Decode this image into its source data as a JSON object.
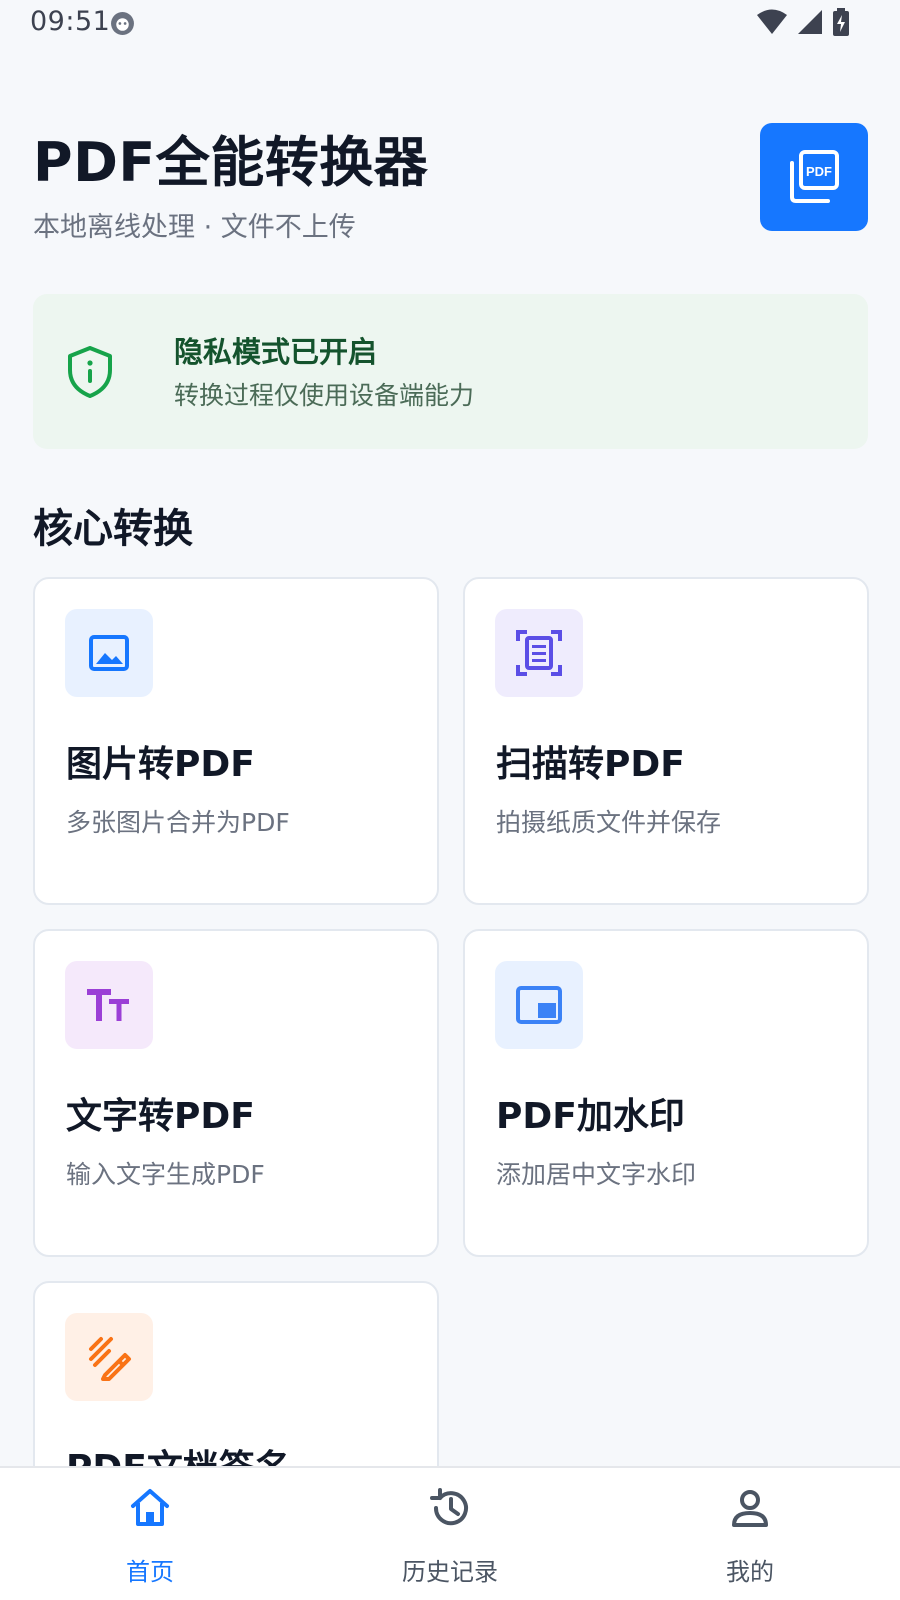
{
  "status_bar": {
    "time": "09:51"
  },
  "header": {
    "title": "PDF全能转换器",
    "subtitle": "本地离线处理 · 文件不上传",
    "logo_text": "PDF",
    "brand_color": "#1677ff"
  },
  "privacy": {
    "title": "隐私模式已开启",
    "description": "转换过程仅使用设备端能力",
    "accent_color": "#16a34a"
  },
  "section": {
    "title": "核心转换"
  },
  "tools": [
    {
      "title": "图片转PDF",
      "description": "多张图片合并为PDF",
      "icon": "image-icon",
      "icon_color": "#1677ff",
      "tile_color": "#e8f1ff"
    },
    {
      "title": "扫描转PDF",
      "description": "拍摄纸质文件并保存",
      "icon": "document-scan-icon",
      "icon_color": "#5b4ee6",
      "tile_color": "#efecfd"
    },
    {
      "title": "文字转PDF",
      "description": "输入文字生成PDF",
      "icon": "text-size-icon",
      "icon_color": "#9b3fd6",
      "tile_color": "#f5e9fb"
    },
    {
      "title": "PDF加水印",
      "description": "添加居中文字水印",
      "icon": "watermark-icon",
      "icon_color": "#3b82f6",
      "tile_color": "#e8f1ff"
    },
    {
      "title": "PDF文档签名",
      "description": "",
      "icon": "signature-icon",
      "icon_color": "#f97316",
      "tile_color": "#fff0e6"
    }
  ],
  "bottom_nav": [
    {
      "label": "首页",
      "icon": "home-icon",
      "active": true
    },
    {
      "label": "历史记录",
      "icon": "history-icon",
      "active": false
    },
    {
      "label": "我的",
      "icon": "profile-icon",
      "active": false
    }
  ]
}
